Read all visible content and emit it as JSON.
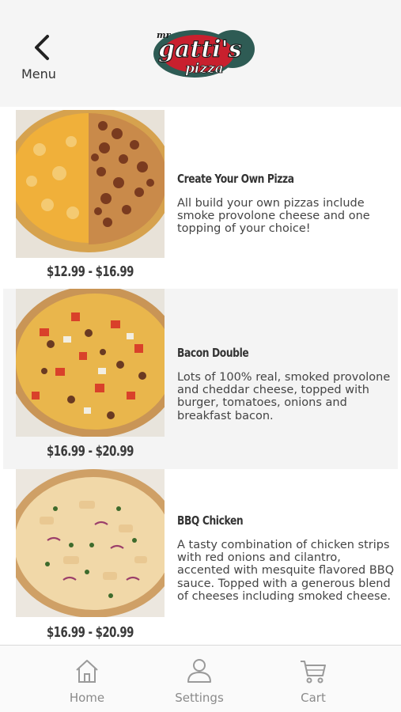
{
  "header": {
    "back_label": "Menu",
    "logo_text_top": "mr",
    "logo_text_main": "gatti's",
    "logo_text_sub": "pizza"
  },
  "items": [
    {
      "title": "Create Your Own Pizza",
      "description": "All build your own pizzas include smoke provolone cheese and one topping of your choice!",
      "price": "$12.99 - $16.99"
    },
    {
      "title": "Bacon Double",
      "description": "Lots of 100% real, smoked provolone and cheddar cheese, topped with burger, tomatoes, onions and breakfast bacon.",
      "price": "$16.99 - $20.99"
    },
    {
      "title": "BBQ Chicken",
      "description": "A tasty combination of chicken strips with red onions and cilantro, accented with mesquite flavored BBQ sauce. Topped with a generous blend of cheeses including smoked cheese.",
      "price": "$16.99 - $20.99"
    }
  ],
  "tabs": [
    {
      "label": "Home",
      "icon": "home-icon"
    },
    {
      "label": "Settings",
      "icon": "person-icon"
    },
    {
      "label": "Cart",
      "icon": "cart-icon"
    }
  ],
  "colors": {
    "header_bg": "#f5f5f5",
    "alt_row_bg": "#f4f4f4",
    "logo_red": "#c8202e",
    "logo_teal": "#2e5b54",
    "tab_gray": "#8a8a8a"
  }
}
